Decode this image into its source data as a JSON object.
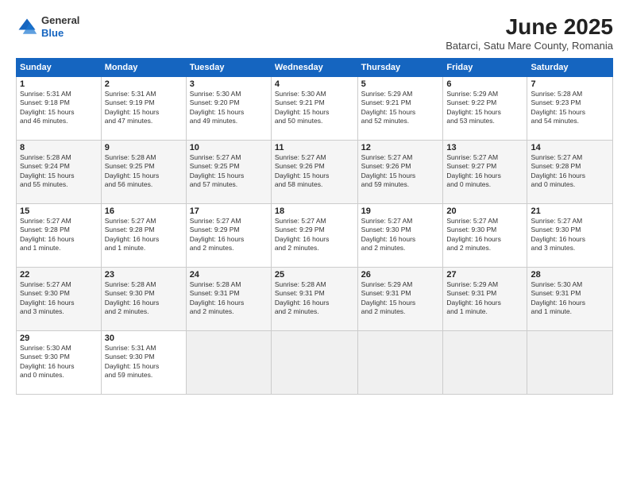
{
  "logo": {
    "general": "General",
    "blue": "Blue"
  },
  "title": "June 2025",
  "subtitle": "Batarci, Satu Mare County, Romania",
  "days_header": [
    "Sunday",
    "Monday",
    "Tuesday",
    "Wednesday",
    "Thursday",
    "Friday",
    "Saturday"
  ],
  "weeks": [
    [
      {
        "day": "1",
        "info": "Sunrise: 5:31 AM\nSunset: 9:18 PM\nDaylight: 15 hours\nand 46 minutes."
      },
      {
        "day": "2",
        "info": "Sunrise: 5:31 AM\nSunset: 9:19 PM\nDaylight: 15 hours\nand 47 minutes."
      },
      {
        "day": "3",
        "info": "Sunrise: 5:30 AM\nSunset: 9:20 PM\nDaylight: 15 hours\nand 49 minutes."
      },
      {
        "day": "4",
        "info": "Sunrise: 5:30 AM\nSunset: 9:21 PM\nDaylight: 15 hours\nand 50 minutes."
      },
      {
        "day": "5",
        "info": "Sunrise: 5:29 AM\nSunset: 9:21 PM\nDaylight: 15 hours\nand 52 minutes."
      },
      {
        "day": "6",
        "info": "Sunrise: 5:29 AM\nSunset: 9:22 PM\nDaylight: 15 hours\nand 53 minutes."
      },
      {
        "day": "7",
        "info": "Sunrise: 5:28 AM\nSunset: 9:23 PM\nDaylight: 15 hours\nand 54 minutes."
      }
    ],
    [
      {
        "day": "8",
        "info": "Sunrise: 5:28 AM\nSunset: 9:24 PM\nDaylight: 15 hours\nand 55 minutes."
      },
      {
        "day": "9",
        "info": "Sunrise: 5:28 AM\nSunset: 9:25 PM\nDaylight: 15 hours\nand 56 minutes."
      },
      {
        "day": "10",
        "info": "Sunrise: 5:27 AM\nSunset: 9:25 PM\nDaylight: 15 hours\nand 57 minutes."
      },
      {
        "day": "11",
        "info": "Sunrise: 5:27 AM\nSunset: 9:26 PM\nDaylight: 15 hours\nand 58 minutes."
      },
      {
        "day": "12",
        "info": "Sunrise: 5:27 AM\nSunset: 9:26 PM\nDaylight: 15 hours\nand 59 minutes."
      },
      {
        "day": "13",
        "info": "Sunrise: 5:27 AM\nSunset: 9:27 PM\nDaylight: 16 hours\nand 0 minutes."
      },
      {
        "day": "14",
        "info": "Sunrise: 5:27 AM\nSunset: 9:28 PM\nDaylight: 16 hours\nand 0 minutes."
      }
    ],
    [
      {
        "day": "15",
        "info": "Sunrise: 5:27 AM\nSunset: 9:28 PM\nDaylight: 16 hours\nand 1 minute."
      },
      {
        "day": "16",
        "info": "Sunrise: 5:27 AM\nSunset: 9:28 PM\nDaylight: 16 hours\nand 1 minute."
      },
      {
        "day": "17",
        "info": "Sunrise: 5:27 AM\nSunset: 9:29 PM\nDaylight: 16 hours\nand 2 minutes."
      },
      {
        "day": "18",
        "info": "Sunrise: 5:27 AM\nSunset: 9:29 PM\nDaylight: 16 hours\nand 2 minutes."
      },
      {
        "day": "19",
        "info": "Sunrise: 5:27 AM\nSunset: 9:30 PM\nDaylight: 16 hours\nand 2 minutes."
      },
      {
        "day": "20",
        "info": "Sunrise: 5:27 AM\nSunset: 9:30 PM\nDaylight: 16 hours\nand 2 minutes."
      },
      {
        "day": "21",
        "info": "Sunrise: 5:27 AM\nSunset: 9:30 PM\nDaylight: 16 hours\nand 3 minutes."
      }
    ],
    [
      {
        "day": "22",
        "info": "Sunrise: 5:27 AM\nSunset: 9:30 PM\nDaylight: 16 hours\nand 3 minutes."
      },
      {
        "day": "23",
        "info": "Sunrise: 5:28 AM\nSunset: 9:30 PM\nDaylight: 16 hours\nand 2 minutes."
      },
      {
        "day": "24",
        "info": "Sunrise: 5:28 AM\nSunset: 9:31 PM\nDaylight: 16 hours\nand 2 minutes."
      },
      {
        "day": "25",
        "info": "Sunrise: 5:28 AM\nSunset: 9:31 PM\nDaylight: 16 hours\nand 2 minutes."
      },
      {
        "day": "26",
        "info": "Sunrise: 5:29 AM\nSunset: 9:31 PM\nDaylight: 15 hours\nand 2 minutes."
      },
      {
        "day": "27",
        "info": "Sunrise: 5:29 AM\nSunset: 9:31 PM\nDaylight: 16 hours\nand 1 minute."
      },
      {
        "day": "28",
        "info": "Sunrise: 5:30 AM\nSunset: 9:31 PM\nDaylight: 16 hours\nand 1 minute."
      }
    ],
    [
      {
        "day": "29",
        "info": "Sunrise: 5:30 AM\nSunset: 9:30 PM\nDaylight: 16 hours\nand 0 minutes."
      },
      {
        "day": "30",
        "info": "Sunrise: 5:31 AM\nSunset: 9:30 PM\nDaylight: 15 hours\nand 59 minutes."
      },
      {
        "day": "",
        "info": ""
      },
      {
        "day": "",
        "info": ""
      },
      {
        "day": "",
        "info": ""
      },
      {
        "day": "",
        "info": ""
      },
      {
        "day": "",
        "info": ""
      }
    ]
  ]
}
